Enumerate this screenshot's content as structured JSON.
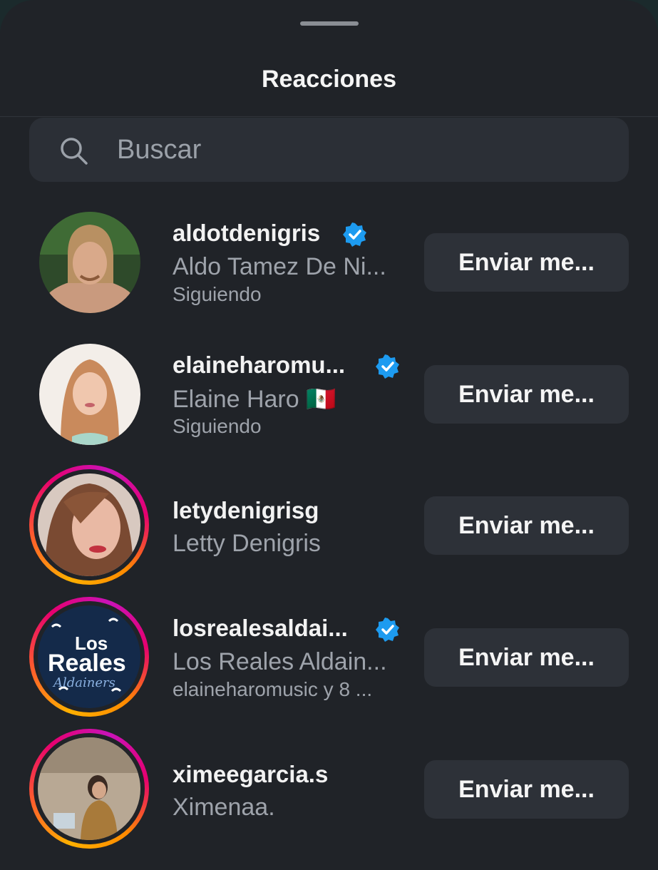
{
  "sheet": {
    "title": "Reacciones"
  },
  "search": {
    "placeholder": "Buscar",
    "icon": "search-icon"
  },
  "colors": {
    "background": "#202328",
    "button": "#2d3138",
    "verified": "#1d9bf0",
    "secondary_text": "#9ea3ab"
  },
  "reactions": [
    {
      "username": "aldotdenigris",
      "verified": true,
      "full_name": "Aldo Tamez De Ni...",
      "meta": "Siguiendo",
      "button": "Enviar me...",
      "story_ring": false
    },
    {
      "username": "elaineharomu...",
      "verified": true,
      "full_name": "Elaine Haro 🇲🇽",
      "meta": "Siguiendo",
      "button": "Enviar me...",
      "story_ring": false
    },
    {
      "username": "letydenigrisg",
      "verified": false,
      "full_name": "Letty Denigris",
      "meta": "",
      "button": "Enviar me...",
      "story_ring": true
    },
    {
      "username": "losrealesaldai...",
      "verified": true,
      "full_name": "Los Reales Aldain...",
      "meta": "elaineharomusic y 8 ...",
      "button": "Enviar me...",
      "story_ring": true,
      "avatar_text": {
        "line1": "Los",
        "line2": "Reales",
        "line3": "Aldainers"
      }
    },
    {
      "username": "ximeegarcia.s",
      "verified": false,
      "full_name": "Ximenaa.",
      "meta": "",
      "button": "Enviar me...",
      "story_ring": true
    }
  ]
}
